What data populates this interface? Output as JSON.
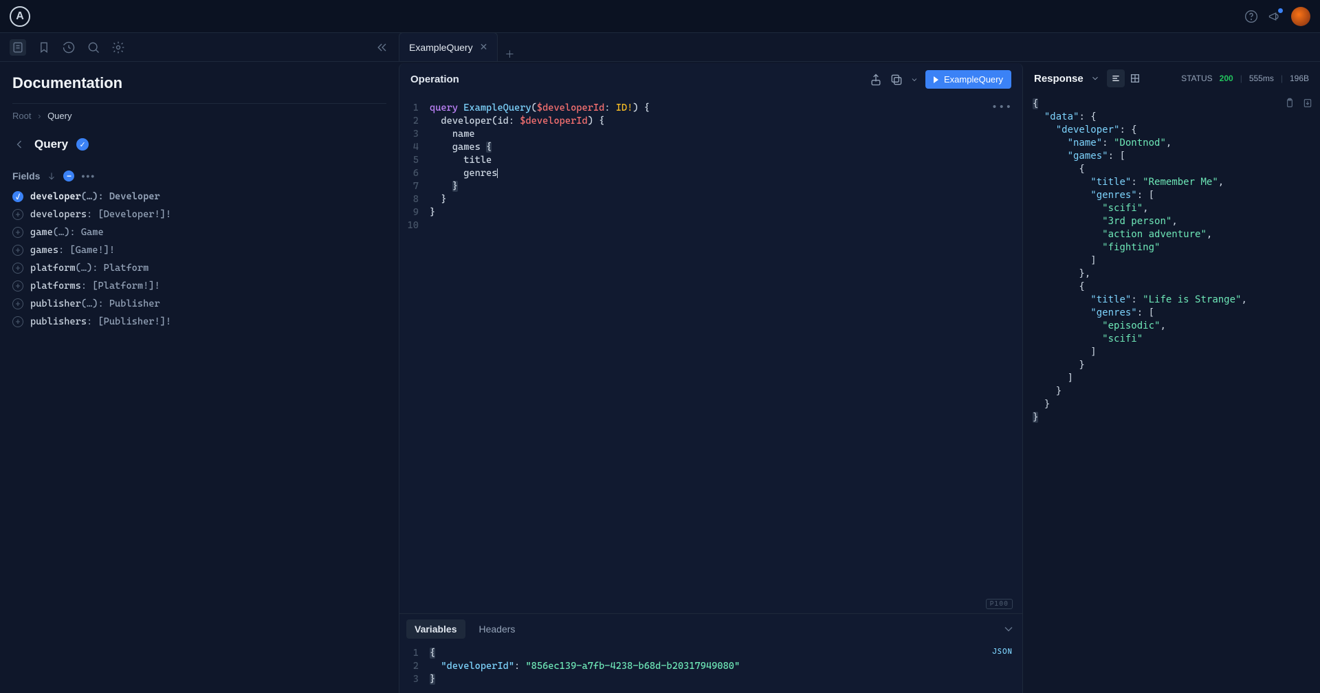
{
  "topbar": {
    "logo_letter": "A"
  },
  "tabs": {
    "active": "ExampleQuery"
  },
  "sidebar": {
    "title": "Documentation",
    "breadcrumb": {
      "root": "Root",
      "current": "Query"
    },
    "page_title": "Query",
    "fields_label": "Fields",
    "fields": [
      {
        "name": "developer",
        "args": "(…)",
        "type": "Developer",
        "selected": true
      },
      {
        "name": "developers",
        "args": "",
        "type": "[Developer!]!",
        "selected": false
      },
      {
        "name": "game",
        "args": "(…)",
        "type": "Game",
        "selected": false
      },
      {
        "name": "games",
        "args": "",
        "type": "[Game!]!",
        "selected": false
      },
      {
        "name": "platform",
        "args": "(…)",
        "type": "Platform",
        "selected": false
      },
      {
        "name": "platforms",
        "args": "",
        "type": "[Platform!]!",
        "selected": false
      },
      {
        "name": "publisher",
        "args": "(…)",
        "type": "Publisher",
        "selected": false
      },
      {
        "name": "publishers",
        "args": "",
        "type": "[Publisher!]!",
        "selected": false
      }
    ]
  },
  "operation": {
    "title": "Operation",
    "run_label": "ExampleQuery",
    "prettier_badge": "P100",
    "code": {
      "query_keyword": "query",
      "op_name": "ExampleQuery",
      "var_name": "$developerId",
      "var_type": "ID!",
      "root_field": "developer",
      "arg_name": "id",
      "field1": "name",
      "field2": "games",
      "field3": "title",
      "field4": "genres"
    }
  },
  "bottom": {
    "tab_variables": "Variables",
    "tab_headers": "Headers",
    "json_badge": "JSON",
    "vars": {
      "key": "developerId",
      "value": "856ec139-a7fb-4238-b68d-b20317949080"
    }
  },
  "response": {
    "title": "Response",
    "status_label": "STATUS",
    "status_code": "200",
    "time": "555ms",
    "size": "196B",
    "data": {
      "developer": {
        "name": "Dontnod",
        "games": [
          {
            "title": "Remember Me",
            "genres": [
              "scifi",
              "3rd person",
              "action adventure",
              "fighting"
            ]
          },
          {
            "title": "Life is Strange",
            "genres": [
              "episodic",
              "scifi"
            ]
          }
        ]
      }
    }
  }
}
